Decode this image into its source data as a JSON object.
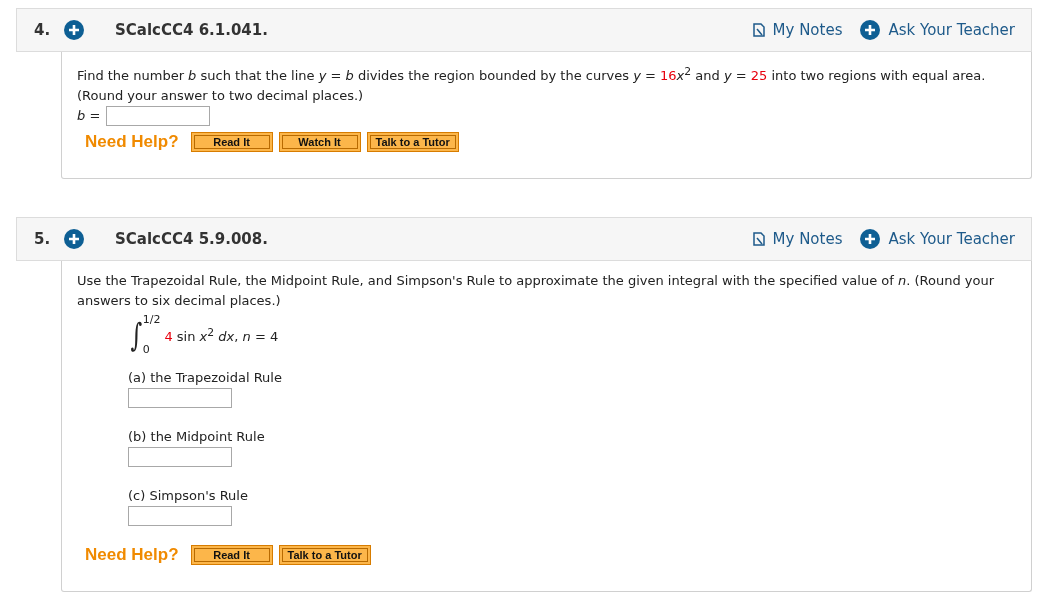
{
  "questions": [
    {
      "number": "4.",
      "title": "SCalcCC4 6.1.041.",
      "notes_label": "My Notes",
      "ask_label": "Ask Your Teacher",
      "prompt": [
        {
          "kind": "text",
          "text": "Find the number *b* such that the line *y* = *b* divides the region bounded by the curves *y* = "
        },
        {
          "kind": "value",
          "text": "16"
        },
        {
          "kind": "text",
          "text": "*x*$^{2}$ and *y* = "
        },
        {
          "kind": "value",
          "text": "25"
        },
        {
          "kind": "text",
          "text": " into two regions with equal area."
        }
      ],
      "note": "(Round your answer to two decimal places.)",
      "parts": [
        {
          "kind": "inline",
          "label": "*b* ="
        }
      ],
      "help_label": "Need Help?",
      "help_buttons": [
        "Read It",
        "Watch It",
        "Talk to a Tutor"
      ]
    },
    {
      "number": "5.",
      "title": "SCalcCC4 5.9.008.",
      "notes_label": "My Notes",
      "ask_label": "Ask Your Teacher",
      "prompt": [
        {
          "kind": "text",
          "text": "Use the Trapezoidal Rule, the Midpoint Rule, and Simpson's Rule to approximate the given integral with the specified value of *n*. (Round your answers to six decimal places.)"
        }
      ],
      "integral": {
        "sign": "∫",
        "upper": "1/2",
        "lower": "0",
        "integrand": [
          {
            "kind": "value",
            "text": "4"
          },
          {
            "kind": "text",
            "text": " sin *x*$^{2}$ *dx*, *n* = 4"
          }
        ]
      },
      "parts": [
        {
          "kind": "stacked",
          "label": "(a) the Trapezoidal Rule"
        },
        {
          "kind": "stacked",
          "label": "(b) the Midpoint Rule"
        },
        {
          "kind": "stacked",
          "label": "(c) Simpson's Rule"
        }
      ],
      "help_label": "Need Help?",
      "help_buttons": [
        "Read It",
        "Talk to a Tutor"
      ]
    }
  ]
}
